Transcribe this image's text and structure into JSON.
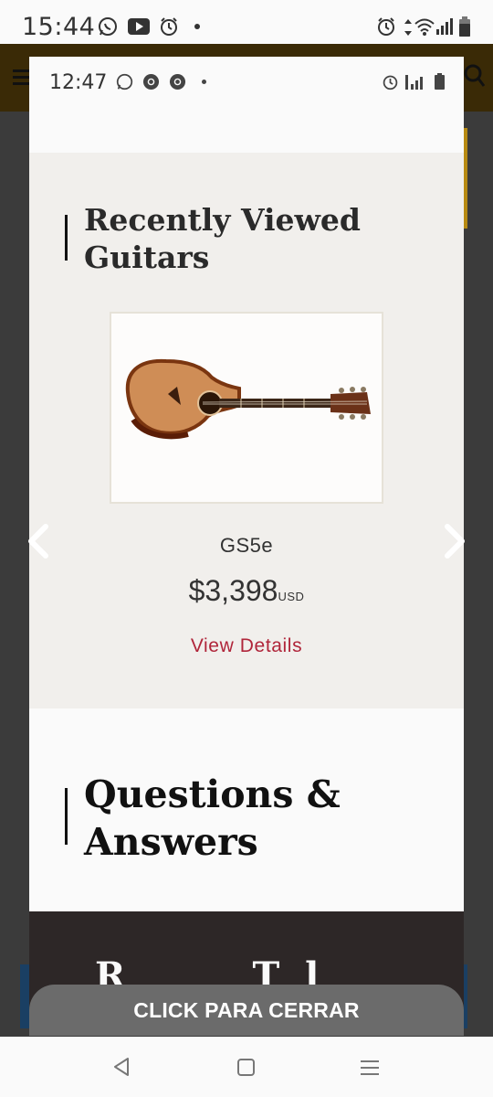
{
  "outer_status": {
    "time": "15:44",
    "left_icons": [
      "whatsapp-icon",
      "youtube-icon",
      "alarm-icon",
      "dot"
    ],
    "right_icons": [
      "alarm-icon",
      "data-arrows-icon",
      "wifi-icon",
      "signal-icon",
      "battery-icon"
    ]
  },
  "inner_status": {
    "time": "12:47",
    "left_icons": [
      "whatsapp-icon",
      "chrome-icon",
      "chrome-icon",
      "dot"
    ],
    "right_icons": [
      "alarm-icon",
      "signal-icon",
      "battery-icon"
    ]
  },
  "recently_viewed": {
    "heading_line1": "Recently Viewed",
    "heading_line2": "Guitars",
    "product": {
      "name": "GS5e",
      "price": "$3,398",
      "currency": "USD",
      "link": "View Details",
      "image": "acoustic-guitar-image"
    }
  },
  "qa": {
    "heading_line1": "Questions &",
    "heading_line2": "Answers"
  },
  "partial_text": "R          T  l",
  "close_button": "CLICK PARA CERRAR",
  "colors": {
    "accent_link": "#b0253a",
    "backdrop": "#3b3b3b",
    "header_brown": "#3a2a06",
    "section_beige": "#f1efec",
    "dark_band": "#2d2727"
  },
  "carousel": {
    "prev_icon": "chevron-left-icon",
    "next_icon": "chevron-right-icon"
  }
}
